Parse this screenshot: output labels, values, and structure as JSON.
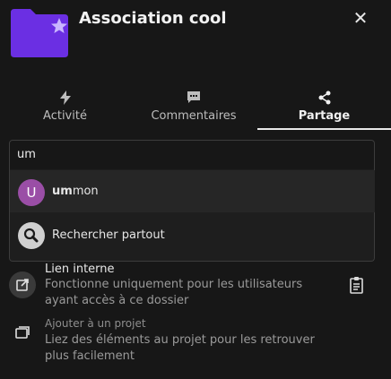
{
  "header": {
    "title": "Association cool"
  },
  "tabs": [
    {
      "label": "Activité",
      "icon": "lightning-icon"
    },
    {
      "label": "Commentaires",
      "icon": "comment-icon"
    },
    {
      "label": "Partage",
      "icon": "share-icon",
      "active": true
    }
  ],
  "search": {
    "value": "um"
  },
  "suggestions": [
    {
      "avatar_letter": "U",
      "match": "um",
      "rest": "mon",
      "avatar_color": "#9a4ea6"
    },
    {
      "label": "Rechercher partout",
      "icon": "search-icon"
    }
  ],
  "internal_link": {
    "title": "Lien interne",
    "description": "Fonctionne uniquement pour les utilisateurs ayant accès à ce dossier",
    "icon": "external-link-icon",
    "action_icon": "clipboard-icon"
  },
  "project": {
    "title": "Ajouter à un projet",
    "description": "Liez des éléments au projet pour les retrouver plus facilement",
    "icon": "project-icon"
  },
  "colors": {
    "background": "#171717",
    "folder": "#6b2fe3",
    "avatar_u": "#9a4ea6"
  }
}
